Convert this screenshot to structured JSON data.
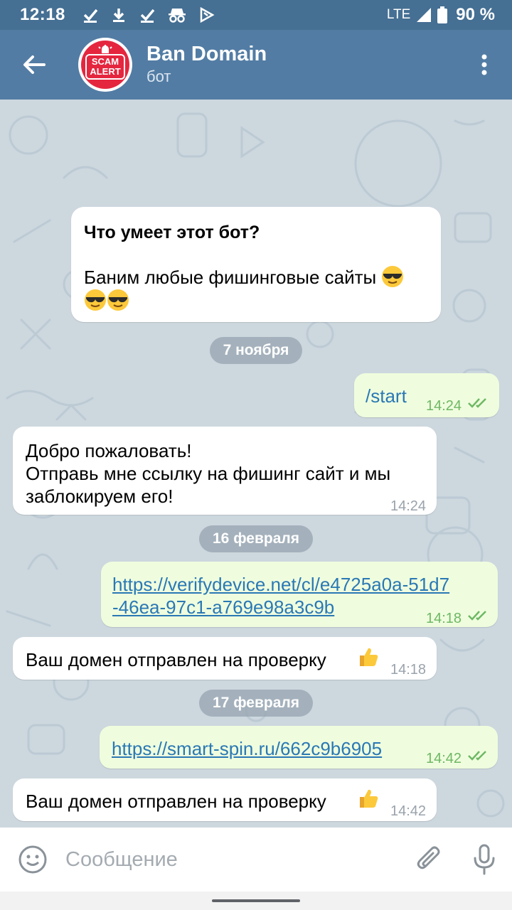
{
  "status_bar": {
    "time": "12:18",
    "network": "LTE",
    "battery": "90 %",
    "icons": [
      "check-download-icon",
      "download-icon",
      "check-download-icon",
      "incognito-icon",
      "play-store-icon"
    ]
  },
  "header": {
    "title": "Ban Domain",
    "subtitle": "бот",
    "avatar_text": [
      "SCAM",
      "ALERT"
    ]
  },
  "intro": {
    "heading": "Что умеет этот бот?",
    "body": "Баним любые фишинговые сайты"
  },
  "date_separators": [
    "7 ноября",
    "16 февраля",
    "17 февраля"
  ],
  "messages": [
    {
      "direction": "out",
      "text": "/start",
      "time": "14:24"
    },
    {
      "direction": "in",
      "lines": [
        "Добро пожаловать!",
        "Отправь мне ссылку на фишинг сайт и мы",
        "заблокируем его!"
      ],
      "time": "14:24"
    },
    {
      "direction": "out",
      "lines": [
        "https://verifydevice.net/cl/e4725a0a-51d7",
        "-46ea-97c1-a769e98a3c9b"
      ],
      "time": "14:18"
    },
    {
      "direction": "in",
      "text": "Ваш домен отправлен на проверку",
      "time": "14:18"
    },
    {
      "direction": "out",
      "text": "https://smart-spin.ru/662c9b6905",
      "time": "14:42"
    },
    {
      "direction": "in",
      "text": "Ваш домен отправлен на проверку",
      "time": "14:42"
    }
  ],
  "composer": {
    "placeholder": "Сообщение"
  },
  "colors": {
    "status_bar": "#456f93",
    "header": "#527ca4",
    "outgoing_bubble": "#effdde",
    "link": "#2a78b5",
    "avatar": "#e5263f"
  }
}
